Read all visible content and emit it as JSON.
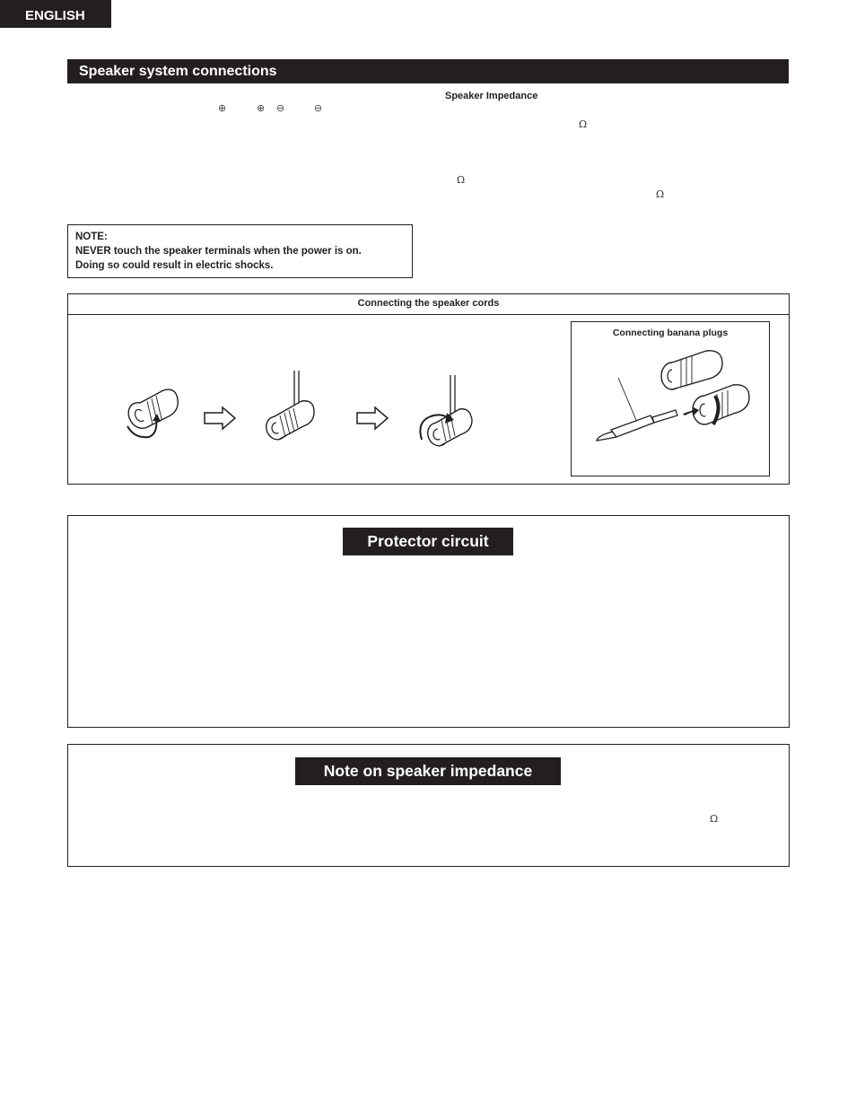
{
  "header": {
    "language_tab": "ENGLISH"
  },
  "speaker_connections": {
    "title": "Speaker system connections",
    "polarity_symbols": [
      "⊕",
      "⊕",
      "⊖",
      "⊖"
    ],
    "impedance_subheading": "Speaker Impedance",
    "omega_symbols": [
      "Ω",
      "Ω",
      "Ω"
    ],
    "note": {
      "label": "NOTE:",
      "line1": "NEVER touch the speaker terminals when the power is on.",
      "line2": "Doing so could result in electric shocks."
    }
  },
  "cords_panel": {
    "title": "Connecting the speaker cords",
    "steps": [
      "loosen-terminal",
      "insert-wire",
      "tighten-terminal"
    ],
    "banana": {
      "title": "Connecting banana plugs"
    }
  },
  "protector": {
    "title": "Protector circuit"
  },
  "impedance_note": {
    "title": "Note on speaker impedance",
    "omega": "Ω"
  }
}
